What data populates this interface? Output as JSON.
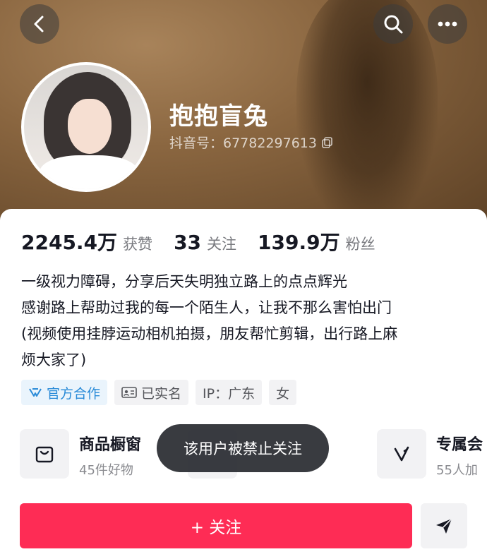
{
  "header": {
    "back_icon": "back-arrow-icon",
    "search_icon": "search-icon",
    "more_icon": "more-dots-icon"
  },
  "profile": {
    "nickname": "抱抱盲兔",
    "douyin_id": "抖音号：67782297613",
    "copy_icon": "copy-icon"
  },
  "stats": [
    {
      "value": "2245.4万",
      "label": "获赞"
    },
    {
      "value": "33",
      "label": "关注"
    },
    {
      "value": "139.9万",
      "label": "粉丝"
    }
  ],
  "bio": [
    "一级视力障碍，分享后天失明独立路上的点点辉光",
    "感谢路上帮助过我的每一个陌生人，让我不那么害怕出门",
    "(视频使用挂脖运动相机拍摄，朋友帮忙剪辑，出行路上麻",
    "烦大家了)"
  ],
  "tags": [
    {
      "label": "官方合作",
      "icon": "official-cooperation-icon"
    },
    {
      "label": "已实名",
      "icon": "id-card-icon"
    },
    {
      "label": "IP：广东"
    },
    {
      "label": "女"
    }
  ],
  "features": [
    {
      "title": "商品橱窗",
      "subtitle": "45件好物",
      "icon": "shopping-bag-icon"
    },
    {
      "title": "",
      "subtitle": "",
      "icon": ""
    },
    {
      "title": "专属会",
      "subtitle": "55人加",
      "icon": "v-badge-icon"
    }
  ],
  "toast": "该用户被禁止关注",
  "actions": {
    "follow_label": "+ 关注",
    "share_icon": "send-icon"
  },
  "colors": {
    "accent": "#fe2c55",
    "official": "#2a8bd8",
    "banner": "#8a6640"
  }
}
